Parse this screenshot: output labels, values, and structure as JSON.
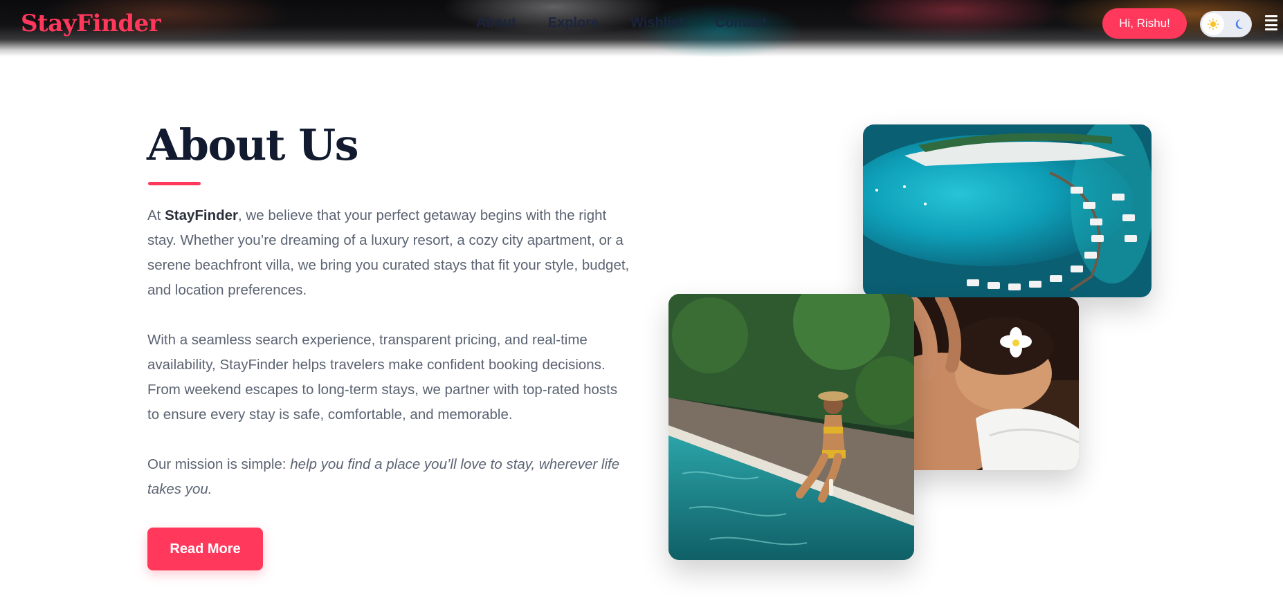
{
  "header": {
    "logo": "StayFinder",
    "nav": [
      "About",
      "Explore",
      "Wishlist",
      "Contact"
    ],
    "greeting": "Hi, Rishu!",
    "theme_icons": [
      "sun-icon",
      "moon-icon"
    ],
    "menu_icon": "hamburger-menu-icon"
  },
  "about": {
    "title": "About Us",
    "p1_pre": "At ",
    "p1_brand": "StayFinder",
    "p1_rest": ", we believe that your perfect getaway begins with the right stay. Whether you’re dreaming of a luxury resort, a cozy city apartment, or a serene beachfront villa, we bring you curated stays that fit your style, budget, and location preferences.",
    "p2": "With a seamless search experience, transparent pricing, and real-time availability, StayFinder helps travelers make confident booking decisions. From weekend escapes to long-term stays, we partner with top-rated hosts to ensure every stay is safe, comfortable, and memorable.",
    "p3_pre": "Our mission is simple: ",
    "p3_italic": "help you find a place you’ll love to stay, wherever life takes you.",
    "button": "Read More"
  },
  "colors": {
    "brand": "#ff385c",
    "heading": "#111a2e",
    "body_text": "#5b6372"
  }
}
